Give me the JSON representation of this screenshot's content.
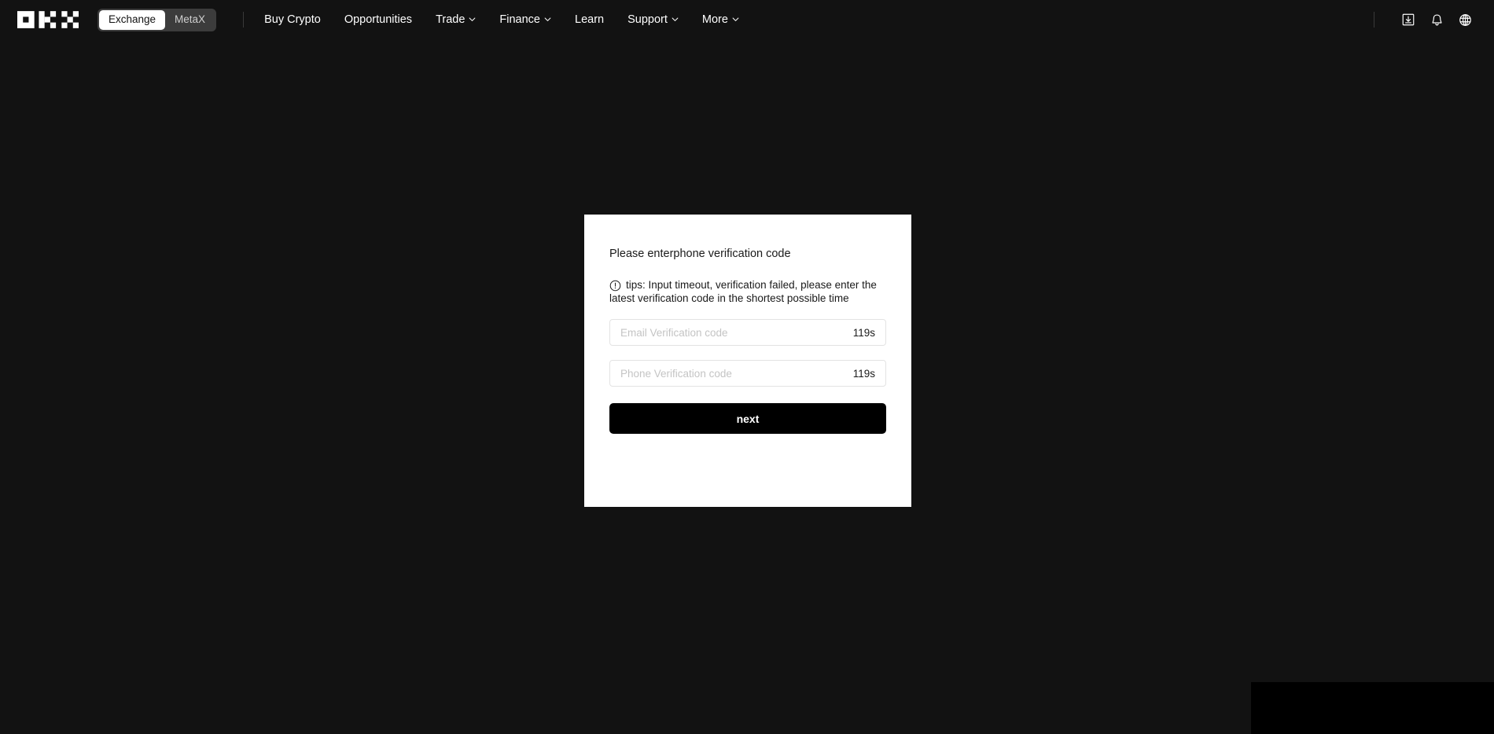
{
  "navbar": {
    "logo_alt": "OKX",
    "segmented": {
      "items": [
        {
          "label": "Exchange",
          "active": true
        },
        {
          "label": "MetaX",
          "active": false
        }
      ]
    },
    "links": [
      {
        "label": "Buy Crypto",
        "caret": false
      },
      {
        "label": "Opportunities",
        "caret": false
      },
      {
        "label": "Trade",
        "caret": true
      },
      {
        "label": "Finance",
        "caret": true
      },
      {
        "label": "Learn",
        "caret": false
      },
      {
        "label": "Support",
        "caret": true
      },
      {
        "label": "More",
        "caret": true
      }
    ],
    "icons": [
      {
        "name": "download-icon"
      },
      {
        "name": "bell-icon"
      },
      {
        "name": "globe-icon"
      }
    ]
  },
  "modal": {
    "title": "Please enterphone verification code",
    "tips_icon": "exclamation-circle-icon",
    "tips_text": "tips: Input timeout, verification failed, please enter the latest verification code in the shortest possible time",
    "fields": [
      {
        "name": "email-verification-code",
        "placeholder": "Email Verification code",
        "value": "",
        "timer": "119s"
      },
      {
        "name": "phone-verification-code",
        "placeholder": "Phone Verification code",
        "value": "",
        "timer": "119s"
      }
    ],
    "submit_label": "next"
  },
  "colors": {
    "page_background": "#121212",
    "card_background": "#ffffff",
    "accent_button": "#000000",
    "text_light": "#ffffff",
    "text_dark": "#1a1a1a",
    "placeholder": "#c4c4c4",
    "field_border": "#e3e3e3",
    "toggle_track": "#3c3c3c"
  }
}
